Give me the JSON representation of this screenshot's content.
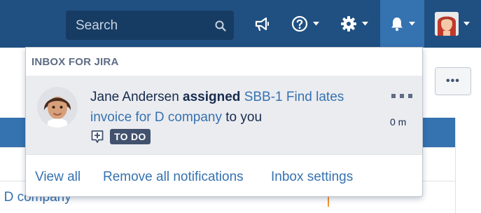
{
  "header": {
    "search_placeholder": "Search",
    "icons": [
      "search-icon",
      "megaphone-icon",
      "help-icon",
      "gear-icon",
      "bell-icon",
      "user-avatar"
    ],
    "colors": {
      "bar": "#205081",
      "search_bg": "#173c64",
      "active_item": "#3572b0"
    }
  },
  "background": {
    "more_label": "•••",
    "visible_link": "r D company"
  },
  "inbox": {
    "title": "INBOX FOR JIRA",
    "notification": {
      "actor": "Jane Andersen",
      "action": "assigned",
      "issue_link": "SBB-1 Find lates invoice for D company",
      "suffix": "to you",
      "status": "TO DO",
      "time": "0 m"
    },
    "footer": {
      "view_all": "View all",
      "remove_all": "Remove all notifications",
      "settings": "Inbox settings"
    }
  }
}
